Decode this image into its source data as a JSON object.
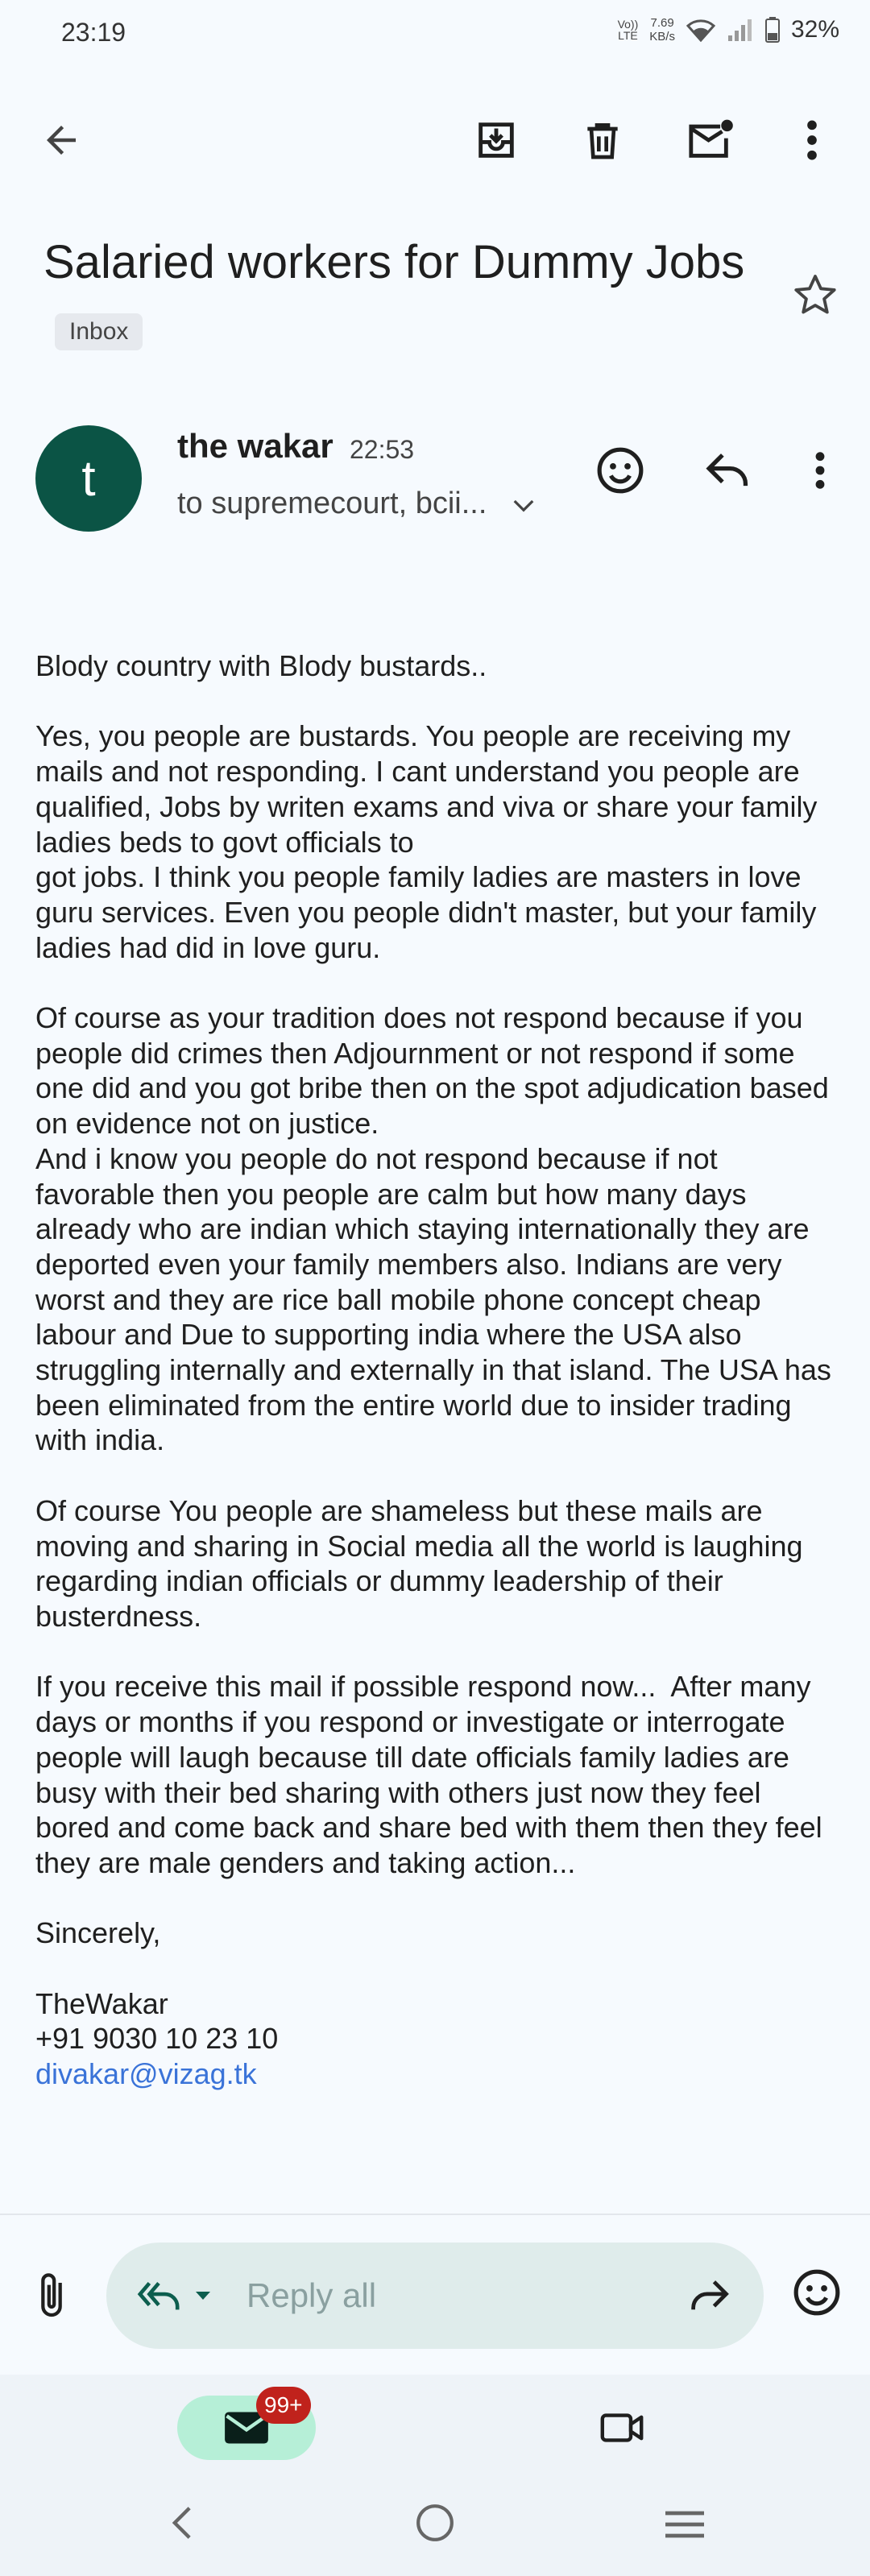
{
  "status_bar": {
    "time": "23:19",
    "network_label": "VoLTE",
    "speed_value": "7.69",
    "speed_unit": "KB/s",
    "battery": "32%"
  },
  "toolbar": {
    "back_icon": "arrow-left-icon",
    "archive_icon": "archive-icon",
    "delete_icon": "trash-icon",
    "mark_unread_icon": "mail-unread-icon",
    "more_icon": "more-vert-icon"
  },
  "email": {
    "subject": "Salaried workers for Dummy Jobs",
    "label": "Inbox",
    "sender_initial": "t",
    "sender_name": "the wakar",
    "time": "22:53",
    "recipients": "to supremecourt, bcii...",
    "avatar_color": "#0b5445"
  },
  "body": {
    "p1": "Blody country with Blody bustards..",
    "p2": "Yes, you people are bustards. You people are receiving my mails and not responding. I cant understand you people are qualified, Jobs by writen exams and viva or share your family ladies beds to govt officials to\ngot jobs. I think you people family ladies are masters in love guru services. Even you people didn't master, but your family ladies had did in love guru.",
    "p3": "Of course as your tradition does not respond because if you people did crimes then Adjournment or not respond if some one did and you got bribe then on the spot adjudication based on evidence not on justice.\nAnd i know you people do not respond because if not favorable then you people are calm but how many days already who are indian which staying internationally they are deported even your family members also. Indians are very worst and they are rice ball mobile phone concept cheap labour and Due to supporting india where the USA also struggling internally and externally in that island. The USA has been eliminated from the entire world due to insider trading with india.",
    "p4": "Of course You people are shameless but these mails are moving and sharing in Social media all the world is laughing regarding indian officials or dummy leadership of their busterdness.",
    "p5": "If you receive this mail if possible respond now...  After many days or months if you respond or investigate or interrogate people will laugh because till date officials family ladies are busy with their bed sharing with others just now they feel bored and come back and share bed with them then they feel they are male genders and taking action...",
    "closing": "Sincerely,",
    "sig_name": "TheWakar",
    "sig_phone": "+91 9030 10 23 10",
    "sig_email": "divakar@vizag.tk"
  },
  "reply_bar": {
    "placeholder": "Reply all",
    "attach_icon": "paperclip-icon",
    "reply_all_icon": "reply-all-icon",
    "forward_icon": "forward-icon",
    "emoji_icon": "emoji-icon"
  },
  "bottom_nav": {
    "mail_badge": "99+",
    "mail_icon": "mail-icon",
    "meet_icon": "video-icon",
    "accent_color": "#b6efd7",
    "badge_color": "#c0221c"
  }
}
